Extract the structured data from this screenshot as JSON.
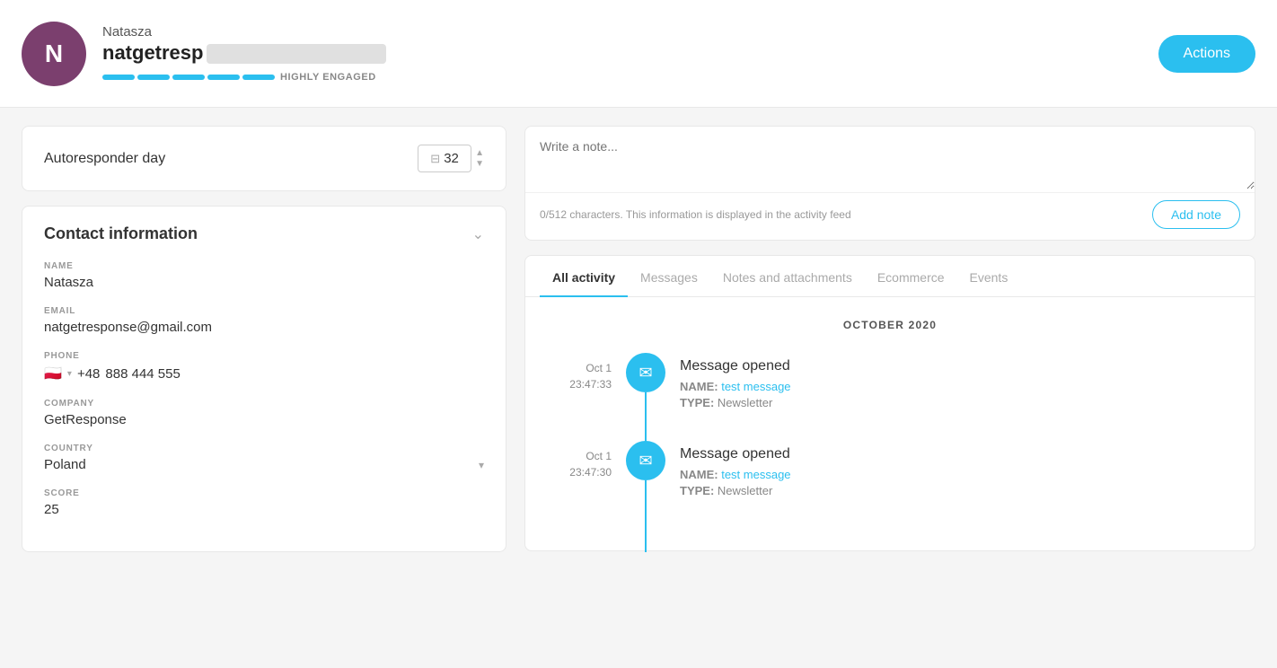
{
  "header": {
    "avatar_letter": "N",
    "avatar_color": "#7b3f6e",
    "contact_name": "Natasza",
    "email_prefix": "natgetresp",
    "engagement_label": "HIGHLY ENGAGED",
    "bar_colors": [
      "#2bbfef",
      "#2bbfef",
      "#2bbfef",
      "#2bbfef",
      "#2bbfef"
    ],
    "actions_label": "Actions"
  },
  "left_panel": {
    "autoresponder": {
      "label": "Autoresponder day",
      "day_value": "32"
    },
    "contact_info": {
      "title": "Contact information",
      "fields": {
        "name_label": "NAME",
        "name_value": "Natasza",
        "email_label": "EMAIL",
        "email_value": "natgetresponse@gmail.com",
        "phone_label": "PHONE",
        "phone_prefix": "+48",
        "phone_number": "888 444 555",
        "company_label": "COMPANY",
        "company_value": "GetResponse",
        "country_label": "COUNTRY",
        "country_value": "Poland",
        "score_label": "SCORE",
        "score_value": "25"
      }
    }
  },
  "right_panel": {
    "note_placeholder": "Write a note...",
    "note_hint": "0/512 characters. This information is displayed in the activity feed",
    "add_note_label": "Add note",
    "tabs": [
      {
        "id": "all-activity",
        "label": "All activity",
        "active": true
      },
      {
        "id": "messages",
        "label": "Messages",
        "active": false
      },
      {
        "id": "notes-attachments",
        "label": "Notes and attachments",
        "active": false
      },
      {
        "id": "ecommerce",
        "label": "Ecommerce",
        "active": false
      },
      {
        "id": "events",
        "label": "Events",
        "active": false
      }
    ],
    "activity": {
      "month_label": "OCTOBER 2020",
      "items": [
        {
          "date": "Oct 1",
          "time": "23:47:33",
          "icon": "✉",
          "title": "Message opened",
          "name_label": "NAME:",
          "name_value": "test message",
          "type_label": "TYPE:",
          "type_value": "Newsletter",
          "has_line": true
        },
        {
          "date": "Oct 1",
          "time": "23:47:30",
          "icon": "✉",
          "title": "Message opened",
          "name_label": "NAME:",
          "name_value": "test message",
          "type_label": "TYPE:",
          "type_value": "Newsletter",
          "has_line": true
        }
      ]
    }
  }
}
